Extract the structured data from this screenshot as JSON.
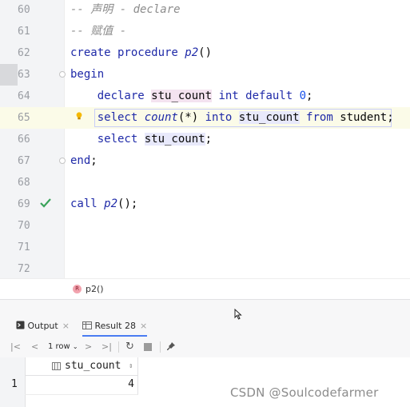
{
  "editor": {
    "lines": [
      {
        "num": "60",
        "parts": [
          {
            "t": "-- 声明 - declare",
            "c": "comment"
          }
        ]
      },
      {
        "num": "61",
        "parts": [
          {
            "t": "-- 赋值 -",
            "c": "comment"
          }
        ]
      },
      {
        "num": "62",
        "parts": [
          {
            "t": "create procedure ",
            "c": "kw"
          },
          {
            "t": "p2",
            "c": "fn"
          },
          {
            "t": "()",
            "c": "plain"
          }
        ]
      },
      {
        "num": "63",
        "parts": [
          {
            "t": "begin",
            "c": "kw"
          }
        ]
      },
      {
        "num": "64",
        "parts": [
          {
            "t": "    declare ",
            "c": "kw"
          },
          {
            "t": "stu_count",
            "c": "plain var-hl"
          },
          {
            "t": " int default ",
            "c": "kw"
          },
          {
            "t": "0",
            "c": "num"
          },
          {
            "t": ";",
            "c": "plain"
          }
        ]
      },
      {
        "num": "65",
        "parts": [
          {
            "t": "    select ",
            "c": "kw"
          },
          {
            "t": "count",
            "c": "fn"
          },
          {
            "t": "(*) ",
            "c": "plain"
          },
          {
            "t": "into ",
            "c": "kw"
          },
          {
            "t": "stu_count",
            "c": "plain var-hl2"
          },
          {
            "t": " from ",
            "c": "kw"
          },
          {
            "t": "student;",
            "c": "plain"
          }
        ]
      },
      {
        "num": "66",
        "parts": [
          {
            "t": "    select ",
            "c": "kw"
          },
          {
            "t": "stu_count",
            "c": "plain var-hl2"
          },
          {
            "t": ";",
            "c": "plain"
          }
        ]
      },
      {
        "num": "67",
        "parts": [
          {
            "t": "end",
            "c": "kw"
          },
          {
            "t": ";",
            "c": "plain"
          }
        ]
      },
      {
        "num": "68",
        "parts": []
      },
      {
        "num": "69",
        "parts": [
          {
            "t": "call ",
            "c": "kw"
          },
          {
            "t": "p2",
            "c": "fn"
          },
          {
            "t": "();",
            "c": "plain"
          }
        ]
      },
      {
        "num": "70",
        "parts": []
      },
      {
        "num": "71",
        "parts": []
      },
      {
        "num": "72",
        "parts": []
      }
    ]
  },
  "breadcrumb": {
    "badge": "R",
    "label": "p2()"
  },
  "tabs": {
    "output": "Output",
    "result": "Result 28"
  },
  "toolbar": {
    "rows": "1 row"
  },
  "grid": {
    "column": "stu_count",
    "rownum": "1",
    "value": "4"
  },
  "watermark": "CSDN @Soulcodefarmer",
  "colors": {
    "keyword": "#1f2aa8",
    "comment": "#8c8c8c",
    "accent": "#4a7cf2"
  }
}
